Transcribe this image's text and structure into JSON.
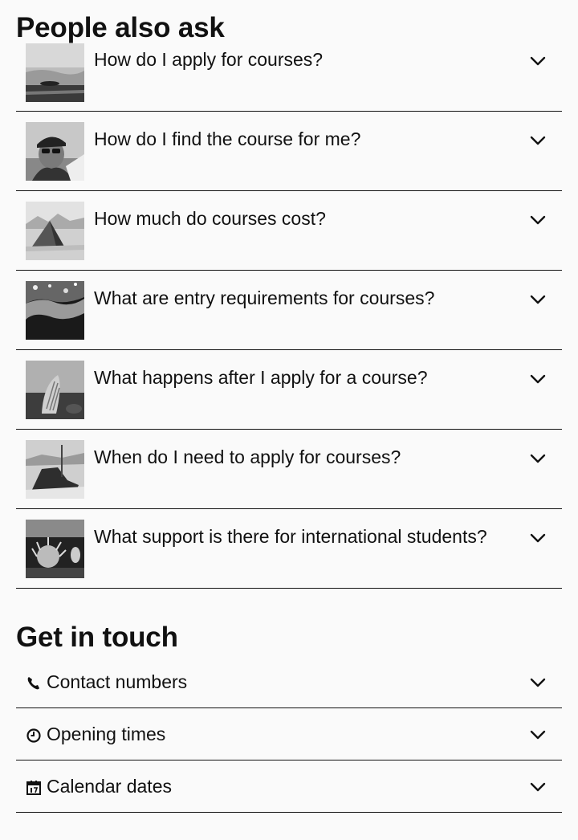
{
  "people_also_ask": {
    "title": "People also ask",
    "items": [
      {
        "question": "How do I apply for courses?",
        "thumbnail": "ice-landscape-photo"
      },
      {
        "question": "How do I find the course for me?",
        "thumbnail": "person-with-sunglasses-photo"
      },
      {
        "question": "How much do courses cost?",
        "thumbnail": "tent-on-snow-photo"
      },
      {
        "question": "What are entry requirements for courses?",
        "thumbnail": "aerial-coastline-photo"
      },
      {
        "question": "What happens after I apply for a course?",
        "thumbnail": "sea-creature-photo"
      },
      {
        "question": "When do I need to apply for courses?",
        "thumbnail": "equipment-on-ice-photo"
      },
      {
        "question": "What support is there for international students?",
        "thumbnail": "seabed-anemone-photo"
      }
    ]
  },
  "get_in_touch": {
    "title": "Get in touch",
    "items": [
      {
        "label": "Contact numbers",
        "icon": "phone-icon"
      },
      {
        "label": "Opening times",
        "icon": "clock-icon"
      },
      {
        "label": "Calendar dates",
        "icon": "calendar-icon"
      }
    ]
  },
  "colors": {
    "background": "#fafafa",
    "text": "#111111",
    "divider": "#111111"
  }
}
